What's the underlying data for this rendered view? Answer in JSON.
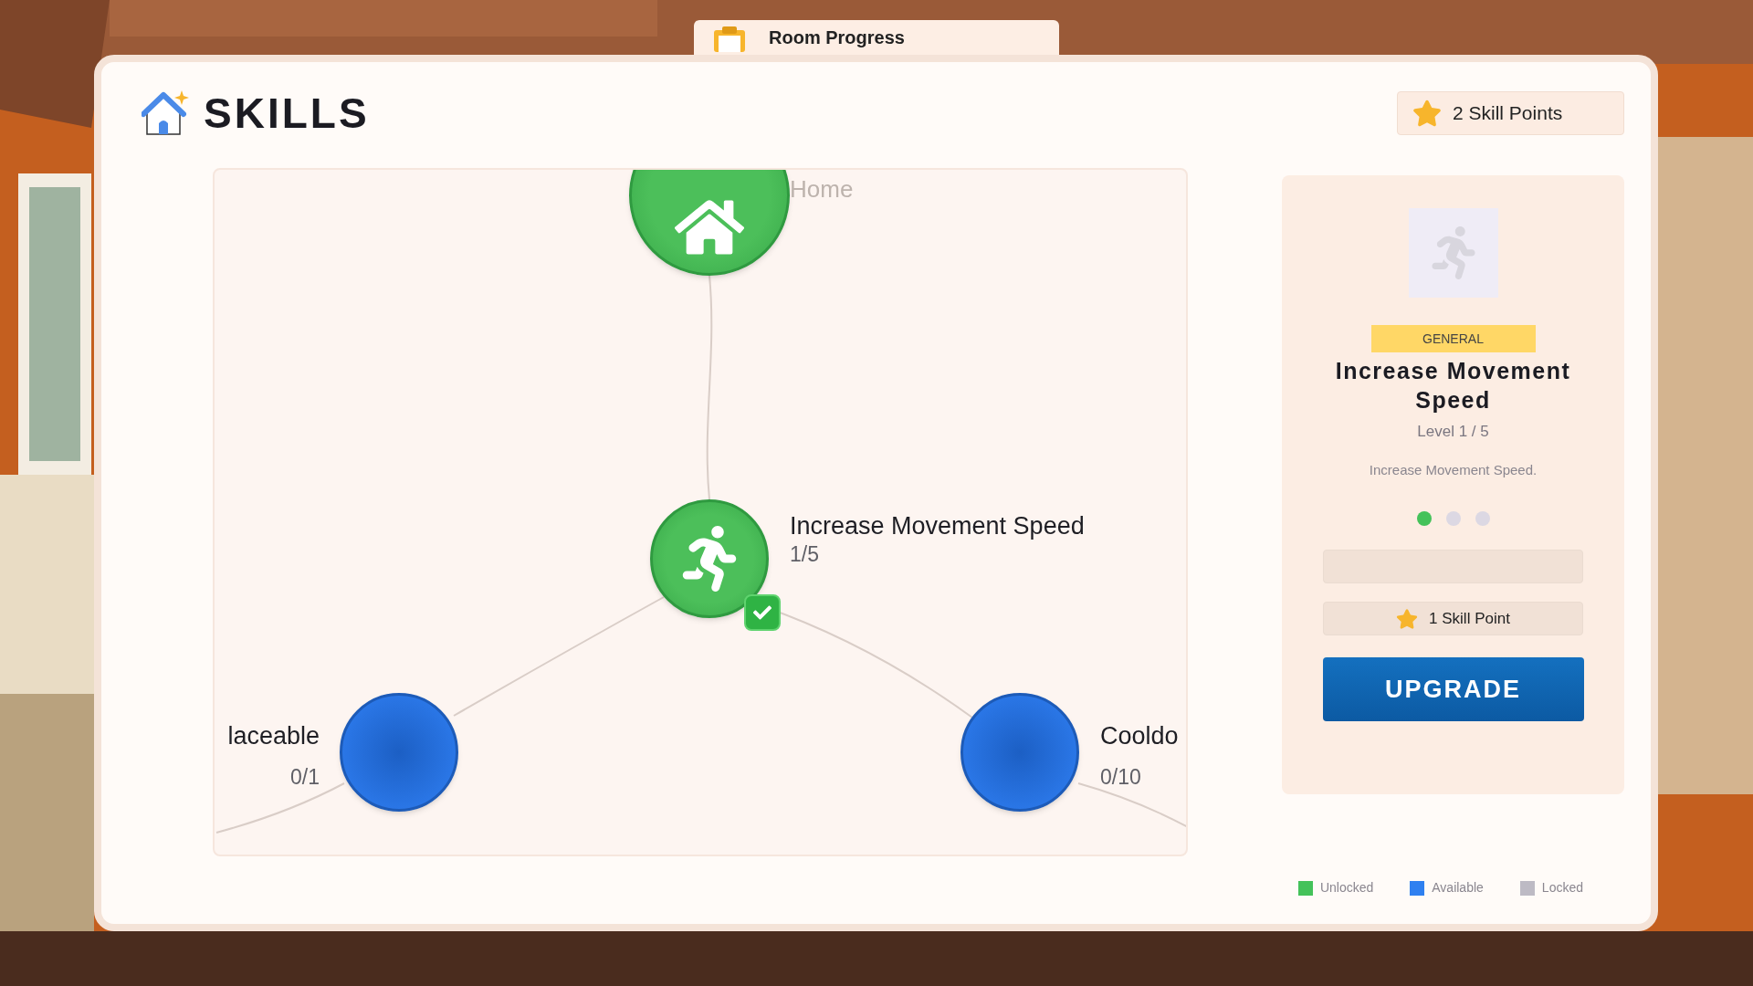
{
  "room_progress_tab": {
    "label": "Room Progress"
  },
  "header": {
    "title": "SKILLS",
    "skill_points": "2 Skill Points"
  },
  "tree": {
    "nodes": [
      {
        "kind": "home",
        "label": "Home",
        "checked": false
      },
      {
        "kind": "unlocked",
        "label": "Increase Movement Speed",
        "progress": "1/5",
        "checked": true
      },
      {
        "kind": "available",
        "label": "laceable",
        "progress": "0/1",
        "checked": false
      },
      {
        "kind": "available",
        "label": "Cooldo",
        "progress": "0/10",
        "checked": false
      }
    ]
  },
  "details": {
    "category": "GENERAL",
    "title": "Increase Movement Speed",
    "level": "Level 1 / 5",
    "description": "Increase Movement Speed.",
    "pips": [
      {
        "on": true
      },
      {
        "on": false
      },
      {
        "on": false
      }
    ],
    "cost": "1 Skill Point",
    "button": "UPGRADE"
  },
  "legend": [
    {
      "label": "Unlocked",
      "color": "#44c25a"
    },
    {
      "label": "Available",
      "color": "#2f80f0"
    },
    {
      "label": "Locked",
      "color": "#bdbac4"
    }
  ]
}
